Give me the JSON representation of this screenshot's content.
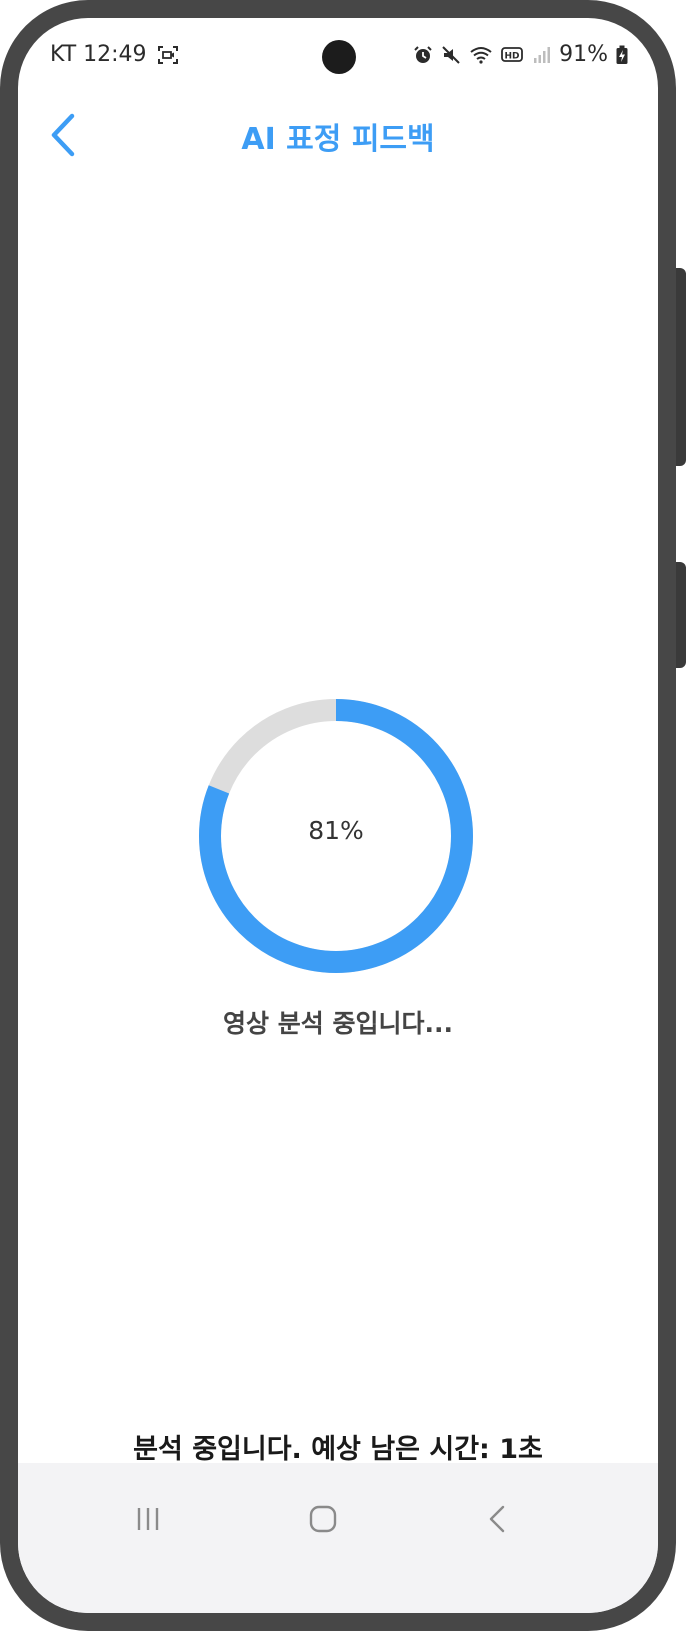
{
  "status_bar": {
    "carrier_time": "KT 12:49",
    "battery": "91%",
    "icons": [
      "screen-record-icon",
      "alarm-icon",
      "mute-icon",
      "wifi-icon",
      "hd-icon",
      "signal-icon",
      "battery-charging-icon"
    ]
  },
  "header": {
    "title": "AI 표정 피드백",
    "back_icon": "chevron-left-icon"
  },
  "progress": {
    "percent": 81,
    "label": "81%",
    "fill_color": "#3d9df5",
    "track_color": "#dddddd"
  },
  "analyzing_text": "영상 분석 중입니다...",
  "remaining_text": "분석 중입니다. 예상 남은 시간: 1초",
  "nav": {
    "items": [
      "recent-apps-icon",
      "home-icon",
      "back-icon"
    ]
  },
  "colors": {
    "accent": "#3d9df5",
    "bezel": "#474747"
  }
}
